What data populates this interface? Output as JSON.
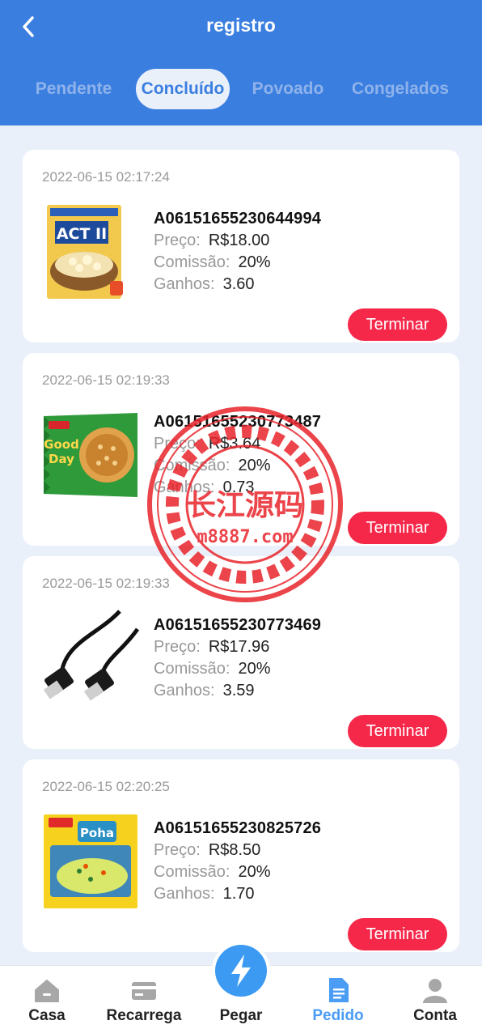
{
  "header": {
    "title": "registro",
    "tabs": [
      {
        "label": "Pendente"
      },
      {
        "label": "Concluído"
      },
      {
        "label": "Povoado"
      },
      {
        "label": "Congelados"
      }
    ]
  },
  "labels": {
    "price": "Preço:",
    "commission": "Comissão:",
    "earnings": "Ganhos:",
    "finish_button": "Terminar"
  },
  "orders": [
    {
      "time": "2022-06-15 02:17:24",
      "id": "A06151655230644994",
      "price": "R$18.00",
      "commission": "20%",
      "earnings": "3.60",
      "product_image": "act-ii-popcorn-package"
    },
    {
      "time": "2022-06-15 02:19:33",
      "id": "A06151655230773487",
      "price": "R$3.64",
      "commission": "20%",
      "earnings": "0.73",
      "product_image": "good-day-biscuits-package"
    },
    {
      "time": "2022-06-15 02:19:33",
      "id": "A06151655230773469",
      "price": "R$17.96",
      "commission": "20%",
      "earnings": "3.59",
      "product_image": "hdmi-cable"
    },
    {
      "time": "2022-06-15 02:20:25",
      "id": "A06151655230825726",
      "price": "R$8.50",
      "commission": "20%",
      "earnings": "1.70",
      "product_image": "maggi-poha-package"
    }
  ],
  "watermark": {
    "text_main": "长江源码",
    "text_site": "m8887.com",
    "color": "#e8242b"
  },
  "bottom_nav": [
    {
      "label": "Casa",
      "icon": "home-icon"
    },
    {
      "label": "Recarrega",
      "icon": "card-icon"
    },
    {
      "label": "Pegar",
      "icon": "lightning-icon"
    },
    {
      "label": "Pedido",
      "icon": "document-icon"
    },
    {
      "label": "Conta",
      "icon": "user-icon"
    }
  ],
  "colors": {
    "primary": "#3a7fe0",
    "accent": "#f5284a",
    "nav_active": "#4a9cf5",
    "background": "#eaf0fa"
  }
}
